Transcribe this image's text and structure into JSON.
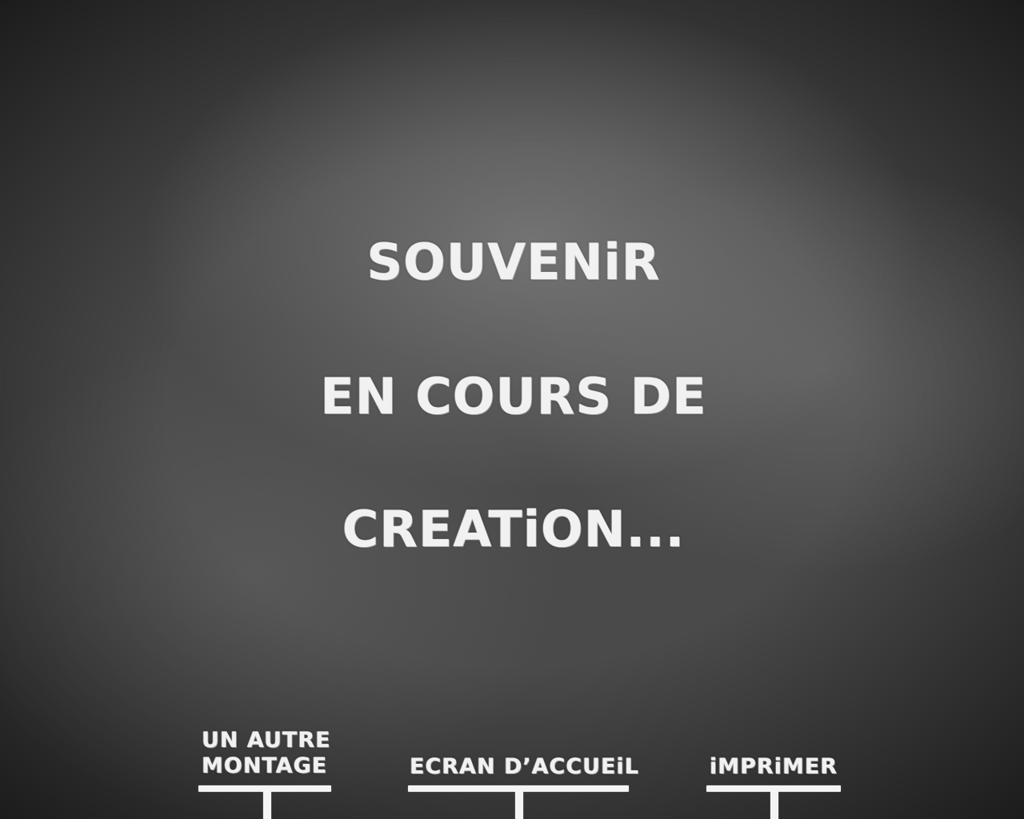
{
  "message": {
    "line1": "SOUVENiR",
    "line2": "EN COURS DE",
    "line3": "CREATiON..."
  },
  "nav": {
    "another_montage_line1": "UN AUTRE",
    "another_montage_line2": "MONTAGE",
    "home_screen": "ECRAN D’ACCUEiL",
    "print": "iMPRiMER"
  },
  "colors": {
    "chalk": "#f1f1f1",
    "board": "#4a4a4a"
  }
}
